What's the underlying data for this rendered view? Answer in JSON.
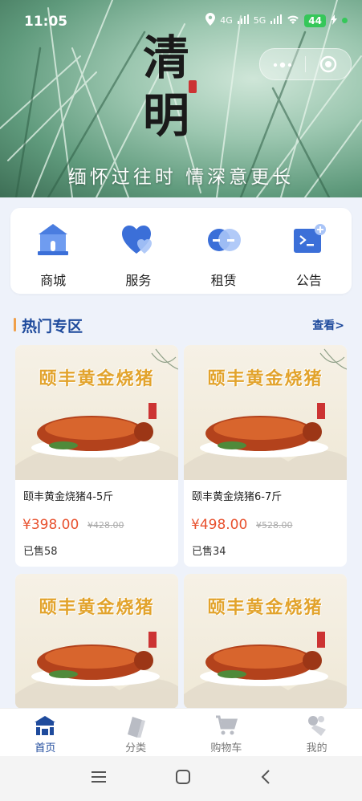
{
  "status_bar": {
    "time": "11:05",
    "network_1": "4G",
    "network_2": "5G",
    "battery": "44"
  },
  "banner": {
    "title_chars": [
      "清",
      "明"
    ],
    "subtitle": "缅怀过往时  情深意更长"
  },
  "capsule": {
    "more_icon": "more-dots-icon",
    "close_icon": "target-close-icon"
  },
  "quick_menu": [
    {
      "label": "商城",
      "icon": "mall-icon",
      "color": "#3b6fd8"
    },
    {
      "label": "服务",
      "icon": "heart-icon",
      "color": "#3b6fd8"
    },
    {
      "label": "租赁",
      "icon": "lease-icon",
      "color": "#3b6fd8"
    },
    {
      "label": "公告",
      "icon": "announcement-icon",
      "color": "#3b6fd8"
    }
  ],
  "hot": {
    "title": "热门专区",
    "more": "查看>",
    "products": [
      {
        "image_text": "颐丰黄金烧猪",
        "name": "颐丰黄金烧猪4-5斤",
        "price": "¥398.00",
        "original_price": "¥428.00",
        "sold": "已售58"
      },
      {
        "image_text": "颐丰黄金烧猪",
        "name": "颐丰黄金烧猪6-7斤",
        "price": "¥498.00",
        "original_price": "¥528.00",
        "sold": "已售34"
      },
      {
        "image_text": "颐丰黄金烧猪",
        "name": "",
        "price": "",
        "original_price": "",
        "sold": ""
      },
      {
        "image_text": "颐丰黄金烧猪",
        "name": "",
        "price": "",
        "original_price": "",
        "sold": ""
      }
    ]
  },
  "tabbar": [
    {
      "label": "首页",
      "icon": "home-icon",
      "active": true
    },
    {
      "label": "分类",
      "icon": "category-icon",
      "active": false
    },
    {
      "label": "购物车",
      "icon": "cart-icon",
      "active": false
    },
    {
      "label": "我的",
      "icon": "profile-icon",
      "active": false
    }
  ],
  "colors": {
    "accent": "#1e4a9c",
    "price": "#e8512e",
    "hot_bar": "#f0a04a"
  }
}
